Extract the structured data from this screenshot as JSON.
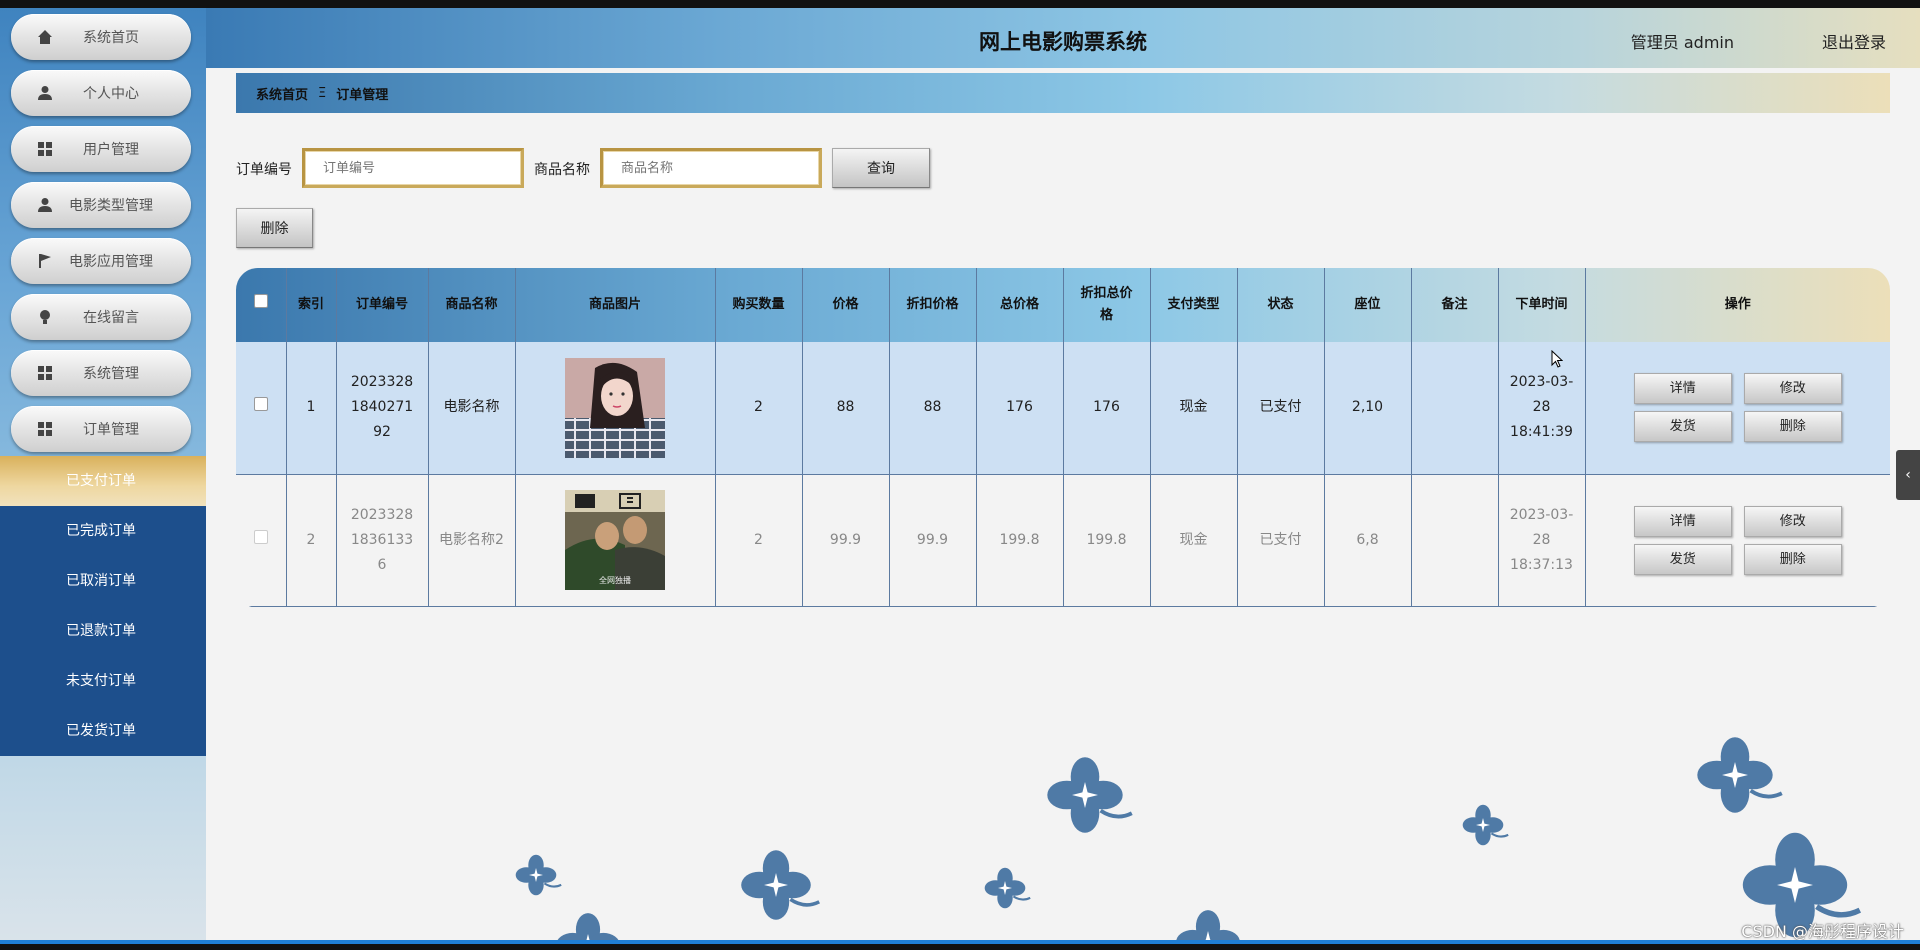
{
  "app": {
    "title": "网上电影购票系统",
    "user": "管理员 admin",
    "logout": "退出登录"
  },
  "sidebar": {
    "items": [
      {
        "label": "系统首页",
        "icon": "home-icon"
      },
      {
        "label": "个人中心",
        "icon": "user-icon"
      },
      {
        "label": "用户管理",
        "icon": "grid-icon"
      },
      {
        "label": "电影类型管理",
        "icon": "user-icon"
      },
      {
        "label": "电影应用管理",
        "icon": "flag-icon"
      },
      {
        "label": "在线留言",
        "icon": "bulb-icon"
      },
      {
        "label": "系统管理",
        "icon": "grid-icon"
      },
      {
        "label": "订单管理",
        "icon": "grid-icon"
      }
    ],
    "submenu": [
      "已支付订单",
      "已完成订单",
      "已取消订单",
      "已退款订单",
      "未支付订单",
      "已发货订单"
    ],
    "active_sub": "已支付订单"
  },
  "breadcrumb": {
    "home": "系统首页",
    "sep": "Ξ",
    "current": "订单管理"
  },
  "search": {
    "order_label": "订单编号",
    "order_placeholder": "订单编号",
    "product_label": "商品名称",
    "product_placeholder": "商品名称",
    "query_button": "查询"
  },
  "toolbar": {
    "delete_button": "删除"
  },
  "table": {
    "headers": [
      "索引",
      "订单编号",
      "商品名称",
      "商品图片",
      "购买数量",
      "价格",
      "折扣价格",
      "总价格",
      "折扣总价格",
      "支付类型",
      "状态",
      "座位",
      "备注",
      "下单时间",
      "操作"
    ],
    "rows": [
      {
        "index": "1",
        "order_no": "2023328184027192",
        "product": "电影名称",
        "qty": "2",
        "price": "88",
        "disc_price": "88",
        "total": "176",
        "disc_total": "176",
        "pay_type": "现金",
        "status": "已支付",
        "seat": "2,10",
        "remark": "",
        "time": "2023-03-28 18:41:39"
      },
      {
        "index": "2",
        "order_no": "202332818361336",
        "product": "电影名称2",
        "qty": "2",
        "price": "99.9",
        "disc_price": "99.9",
        "total": "199.8",
        "disc_total": "199.8",
        "pay_type": "现金",
        "status": "已支付",
        "seat": "6,8",
        "remark": "",
        "time": "2023-03-28 18:37:13"
      }
    ],
    "ops": [
      "详情",
      "修改",
      "发货",
      "删除"
    ]
  },
  "watermark": "CSDN @海彤程序设计",
  "side_tab": "‹"
}
